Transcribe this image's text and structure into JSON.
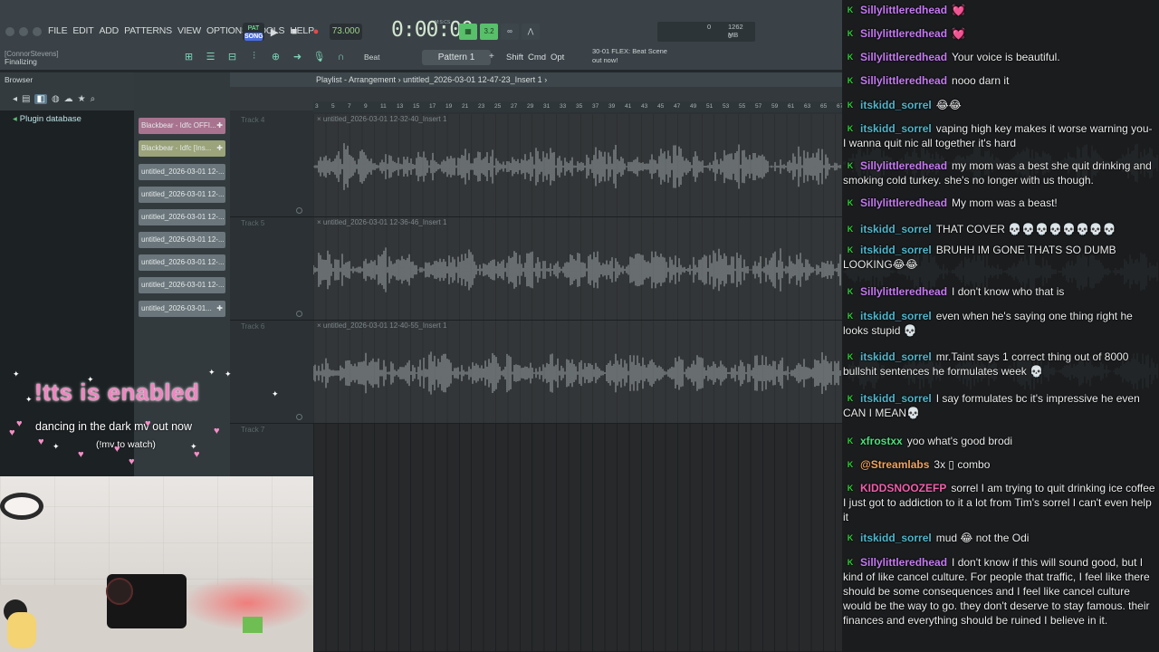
{
  "menu": [
    "FILE",
    "EDIT",
    "ADD",
    "PATTERNS",
    "VIEW",
    "OPTIONS",
    "TOOLS",
    "HELP"
  ],
  "project": {
    "user": "[ConnorStevens]",
    "status": "Finalizing"
  },
  "transport": {
    "mode": "SONG",
    "mode_alt": "PAT",
    "tempo": "73.000",
    "time": "0:00:00",
    "time_unit": "M:S:CS"
  },
  "rec_modes": [
    "3.2"
  ],
  "cpu": {
    "num": "0",
    "mem": "1262 MB",
    "poly": "0"
  },
  "toolbar": {
    "beat_label": "Beat",
    "pattern": "Pattern 1",
    "pattern_add": "+",
    "shift": "Shift",
    "cmd": "Cmd",
    "opt": "Opt",
    "news": "30-01 FLEX: Beat Scene out now!"
  },
  "browser": {
    "title": "Browser",
    "item": "Plugin database"
  },
  "picker_clips": [
    {
      "label": "Blackbear - Idfc OFFI...",
      "color": "pk"
    },
    {
      "label": "Blackbear - Idfc [Ins...",
      "color": "yl"
    },
    {
      "label": "untitled_2026-03-01 12-...",
      "color": "gr"
    },
    {
      "label": "untitled_2026-03-01 12-...",
      "color": "gr"
    },
    {
      "label": "untitled_2026-03-01 12-...",
      "color": "gr"
    },
    {
      "label": "untitled_2026-03-01 12-...",
      "color": "gr"
    },
    {
      "label": "untitled_2026-03-01 12-...",
      "color": "gr"
    },
    {
      "label": "untitled_2026-03-01 12-...",
      "color": "gr"
    },
    {
      "label": "untitled_2026-03-01...",
      "color": "gr"
    }
  ],
  "playlist": {
    "title": "Playlist - Arrangement",
    "file": "untitled_2026-03-01 12-47-23_Insert 1",
    "ruler": [
      "3",
      "5",
      "7",
      "9",
      "11",
      "13",
      "15",
      "17",
      "19",
      "21",
      "23",
      "25",
      "27",
      "29",
      "31",
      "33",
      "35",
      "37",
      "39",
      "41",
      "43",
      "45",
      "47",
      "49",
      "51",
      "53",
      "55",
      "57",
      "59",
      "61",
      "63",
      "65",
      "67",
      "69"
    ],
    "tracks": [
      {
        "label": "Track 4",
        "clip": "untitled_2026-03-01 12-32-40_Insert 1"
      },
      {
        "label": "Track 5",
        "clip": "untitled_2026-03-01 12-36-46_Insert 1"
      },
      {
        "label": "Track 6",
        "clip": "untitled_2026-03-01 12-40-55_Insert 1"
      },
      {
        "label": "Track 7",
        "clip": ""
      }
    ]
  },
  "overlay": {
    "tts": "!tts is enabled",
    "mv_line": "dancing in the dark mv out now",
    "mv_sub": "(!mv to watch)"
  },
  "chat": [
    {
      "user": "Sillylittleredhead",
      "color": "purple",
      "text": "💓"
    },
    {
      "user": "Sillylittleredhead",
      "color": "purple",
      "text": "💓"
    },
    {
      "user": "Sillylittleredhead",
      "color": "purple",
      "text": "Your voice is beautiful."
    },
    {
      "user": "Sillylittleredhead",
      "color": "purple",
      "text": "nooo darn it"
    },
    {
      "user": "itskidd_sorrel",
      "color": "teal",
      "text": "😂😂"
    },
    {
      "user": "itskidd_sorrel",
      "color": "teal",
      "text": "vaping high key makes it worse warning you- I wanna quit nic all together it's hard"
    },
    {
      "user": "Sillylittleredhead",
      "color": "purple",
      "text": "my mom was a best she quit drinking and smoking cold turkey. she's no longer with us though."
    },
    {
      "user": "Sillylittleredhead",
      "color": "purple",
      "text": "My mom was a beast!"
    },
    {
      "user": "itskidd_sorrel",
      "color": "teal",
      "text": "THAT COVER 💀💀💀💀💀💀💀💀"
    },
    {
      "user": "itskidd_sorrel",
      "color": "teal",
      "text": "BRUHH IM GONE THATS SO DUMB LOOKING😂😂"
    },
    {
      "user": "Sillylittleredhead",
      "color": "purple",
      "text": "I don't know who that is"
    },
    {
      "user": "itskidd_sorrel",
      "color": "teal",
      "text": "even when he's saying one thing right he looks stupid 💀"
    },
    {
      "user": "itskidd_sorrel",
      "color": "teal",
      "text": "mr.Taint says 1 correct thing out of 8000 bullshit sentences he formulates week 💀"
    },
    {
      "user": "itskidd_sorrel",
      "color": "teal",
      "text": "I say formulates bc it's impressive he even CAN I MEAN💀"
    },
    {
      "user": "xfrostxx",
      "color": "green",
      "text": "yoo what's good brodi"
    },
    {
      "user": "@Streamlabs",
      "color": "orange",
      "text": "3x ▯ combo"
    },
    {
      "user": "KIDDSNOOZEFP",
      "color": "pink",
      "text": "sorrel I am trying to quit drinking ice coffee I just got to addiction to it a lot from Tim's sorrel I can't even help it"
    },
    {
      "user": "itskidd_sorrel",
      "color": "teal",
      "text": "mud 😂 not the Odi"
    },
    {
      "user": "Sillylittleredhead",
      "color": "purple",
      "text": "I don't know if this will sound good, but I kind of like cancel culture. For people that traffic, I feel like there should be some consequences and I feel like cancel culture would be the way to go. they don't deserve to stay famous. their finances and everything should be ruined I believe in it."
    }
  ]
}
